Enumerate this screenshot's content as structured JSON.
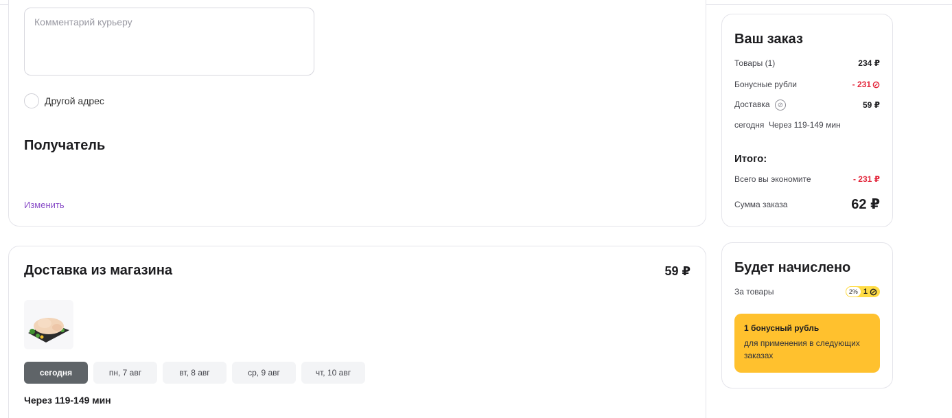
{
  "address_section": {
    "comment_placeholder": "Комментарий курьеру",
    "other_address_label": "Другой адрес",
    "recipient_title": "Получатель",
    "change_link": "Изменить"
  },
  "delivery": {
    "title": "Доставка из магазина",
    "price": "59 ₽",
    "product_image": "chicken-product-image",
    "date_tabs": [
      {
        "label": "сегодня",
        "active": true
      },
      {
        "label": "пн, 7 авг",
        "active": false
      },
      {
        "label": "вт, 8 авг",
        "active": false
      },
      {
        "label": "ср, 9 авг",
        "active": false
      },
      {
        "label": "чт, 10 авг",
        "active": false
      }
    ],
    "eta": "Через 119-149 мин"
  },
  "order": {
    "title": "Ваш заказ",
    "goods_label": "Товары (1)",
    "goods_value": "234 ₽",
    "bonus_label": "Бонусные рубли",
    "bonus_value": "- 231",
    "delivery_label": "Доставка",
    "delivery_value": "59 ₽",
    "delivery_time": "сегодня  Через 119-149 мин",
    "total_title": "Итого:",
    "savings_label": "Всего вы экономите",
    "savings_value": "- 231 ₽",
    "sum_label": "Сумма заказа",
    "sum_value": "62 ₽"
  },
  "bonus": {
    "title": "Будет начислено",
    "for_goods_label": "За товары",
    "percent": "2%",
    "amount": "1",
    "box_title": "1 бонусный рубль",
    "box_text": "для применения в следующих заказах"
  },
  "colors": {
    "accent_link": "#8a4fc8",
    "negative": "#e3253a",
    "bonus_yellow": "#ffc12e",
    "pill_yellow": "#ffdc45",
    "active_tab": "#5f6468"
  }
}
